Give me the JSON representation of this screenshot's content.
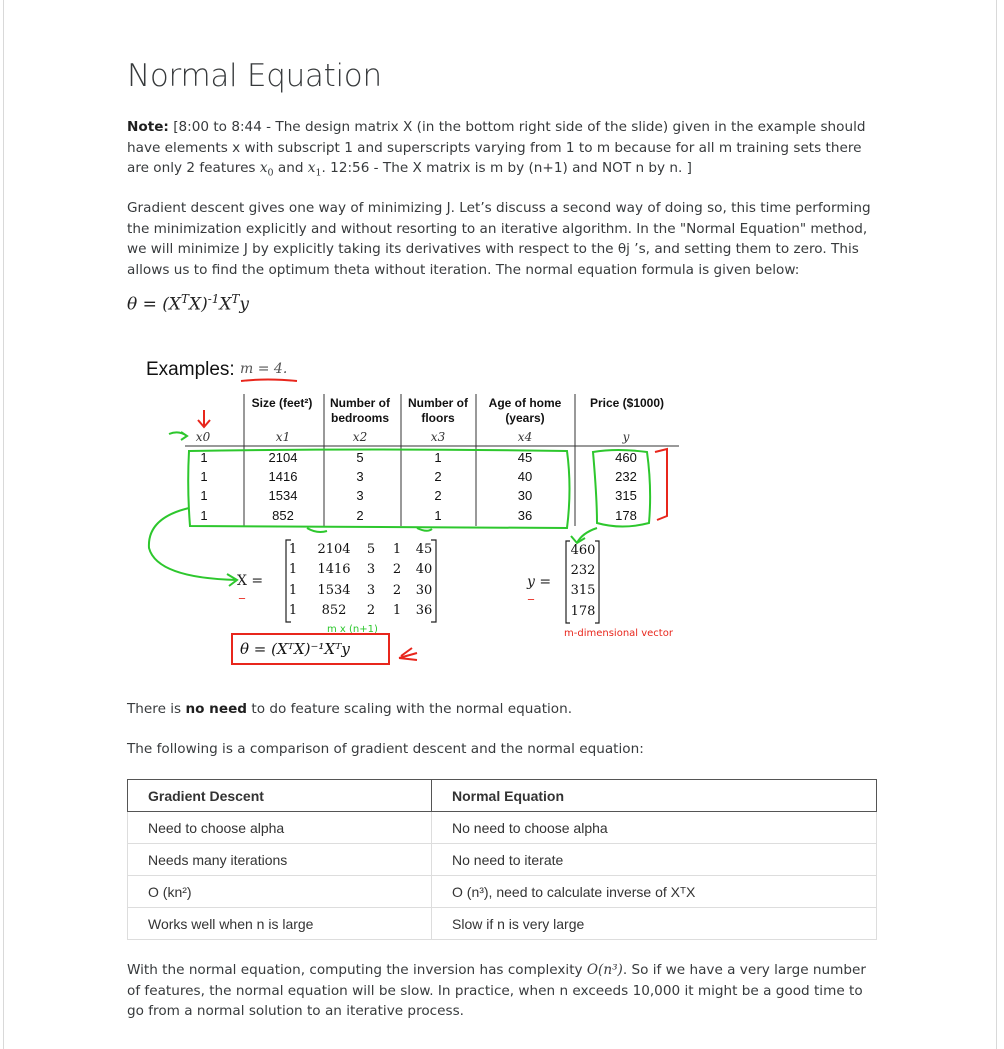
{
  "page": {
    "title": "Normal Equation"
  },
  "note": {
    "label": "Note:",
    "text_1": " [8:00 to 8:44 - The design matrix X (in the bottom right side of the slide) given in the example should have elements x with subscript 1 and superscripts varying from 1 to m because for all m training sets there are only 2 features ",
    "x0": "x",
    "x0_sub": "0",
    "and": " and ",
    "x1": "x",
    "x1_sub": "1",
    "text_2": ". 12:56 - The X matrix is m by (n+1) and NOT n by n. ]"
  },
  "intro": {
    "text": "Gradient descent gives one way of minimizing J. Let’s discuss a second way of doing so, this time performing the minimization explicitly and without resorting to an iterative algorithm. In the \"Normal Equation\" method, we will minimize J by explicitly taking its derivatives with respect to the θj ’s, and setting them to zero. This allows us to find the optimum theta without iteration. The normal equation formula is given below:"
  },
  "formula": {
    "lhs": "θ = (X",
    "t1": "T",
    "mid": "X)",
    "inv": "-1",
    "x": "X",
    "t2": "T",
    "y": "y"
  },
  "slide": {
    "examples_label": "Examples:",
    "m_label": "m = 4.",
    "headers": [
      "Size (feet²)",
      "Number of",
      "bedrooms",
      "Number of",
      "floors",
      "Age of home",
      "(years)",
      "Price ($1000)"
    ],
    "vars": [
      "x0",
      "x1",
      "x2",
      "x3",
      "x4",
      "y"
    ],
    "rows": [
      [
        "1",
        "2104",
        "5",
        "1",
        "45",
        "460"
      ],
      [
        "1",
        "1416",
        "3",
        "2",
        "40",
        "232"
      ],
      [
        "1",
        "1534",
        "3",
        "2",
        "30",
        "315"
      ],
      [
        "1",
        "852",
        "2",
        "1",
        "36",
        "178"
      ]
    ],
    "x_eq": "X =",
    "y_eq": "y =",
    "matrix_x": [
      [
        "1",
        "2104",
        "5",
        "1",
        "45"
      ],
      [
        "1",
        "1416",
        "3",
        "2",
        "40"
      ],
      [
        "1",
        "1534",
        "3",
        "2",
        "30"
      ],
      [
        "1",
        "852",
        "2",
        "1",
        "36"
      ]
    ],
    "vector_y": [
      "460",
      "232",
      "315",
      "178"
    ],
    "dims_note": "m x (n+1)",
    "vector_note": "m-dimensional vector",
    "boxed_formula": "θ = (XᵀX)⁻¹Xᵀy"
  },
  "no_need": {
    "before": "There is ",
    "bold": "no need",
    "after": " to do feature scaling with the normal equation."
  },
  "comparison_intro": "The following is a comparison of gradient descent and the normal equation:",
  "comparison": {
    "headers": [
      "Gradient Descent",
      "Normal Equation"
    ],
    "rows": [
      [
        "Need to choose alpha",
        "No need to choose alpha"
      ],
      [
        "Needs many iterations",
        "No need to iterate"
      ],
      [
        "O (kn²)",
        "O (n³), need to calculate inverse of XᵀX"
      ],
      [
        "Works well when n is large",
        "Slow if n is very large"
      ]
    ]
  },
  "closing": {
    "text_1": "With the normal equation, computing the inversion has complexity ",
    "complexity": "O(n³)",
    "text_2": ". So if we have a very large number of features, the normal equation will be slow. In practice, when n exceeds 10,000 it might be a good time to go from a normal solution to an iterative process."
  },
  "colors": {
    "text": "#373a3c",
    "annotation_red": "#e8261c",
    "annotation_green": "#2dc72d",
    "border": "#d9d9d9"
  }
}
